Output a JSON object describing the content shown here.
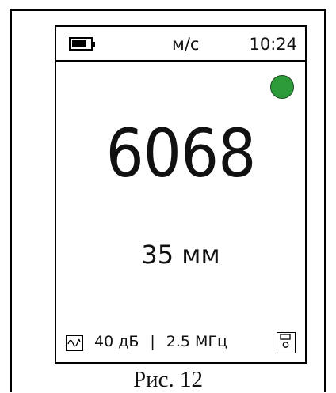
{
  "device": {
    "battery_level": 0.85,
    "unit": "м/с",
    "time": "10:24",
    "status_color": "#2e9b3b",
    "velocity": "6068",
    "thickness": "35 мм",
    "gain": "40 дБ",
    "separator": "|",
    "frequency": "2.5 МГц"
  },
  "caption": "Рис. 12",
  "icons": {
    "battery": "battery-icon",
    "wave": "waveform-icon",
    "save": "save-icon"
  }
}
